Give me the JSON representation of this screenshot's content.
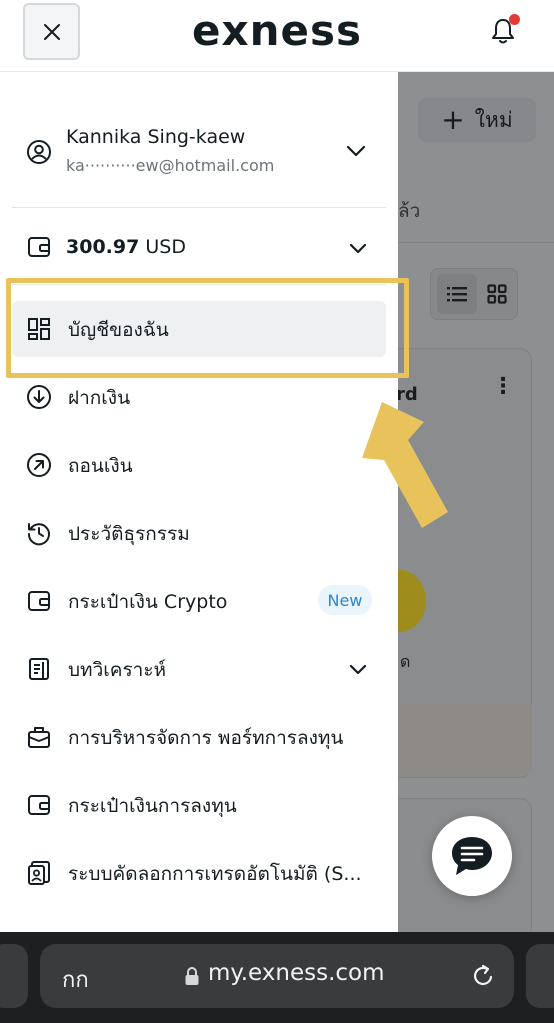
{
  "header": {
    "logo": "exness"
  },
  "background_page": {
    "new_button_label": "ใหม่",
    "partial_text_1": "ล้ว",
    "card_title_partial": "rd",
    "card_more": "⋮",
    "yellow_label_partial": "ด"
  },
  "drawer": {
    "user": {
      "name": "Kannika Sing-kaew",
      "email": "ka··········ew@hotmail.com"
    },
    "balance": {
      "amount": "300.97",
      "currency": "USD"
    },
    "menu": [
      {
        "label": "บัญชีของฉัน",
        "icon": "dashboard-icon",
        "active": true
      },
      {
        "label": "ฝากเงิน",
        "icon": "deposit-icon"
      },
      {
        "label": "ถอนเงิน",
        "icon": "withdraw-icon"
      },
      {
        "label": "ประวัติธุรกรรม",
        "icon": "history-icon"
      },
      {
        "label": "กระเป๋าเงิน Crypto",
        "icon": "wallet-icon",
        "badge": "New"
      },
      {
        "label": "บทวิเคราะห์",
        "icon": "analytics-icon",
        "expandable": true
      },
      {
        "label": "การบริหารจัดการ พอร์ทการลงทุน",
        "icon": "portfolio-icon"
      },
      {
        "label": "กระเป๋าเงินการลงทุน",
        "icon": "wallet-icon"
      },
      {
        "label": "ระบบคัดลอกการเทรดอัตโนมัติ (S...",
        "icon": "copy-trading-icon"
      }
    ]
  },
  "browser": {
    "text_size": "กก",
    "url": "my.exness.com"
  },
  "colors": {
    "highlight": "#e8c35c",
    "badge_text": "#2f86c8",
    "badge_bg": "#eaf4fb",
    "notification_dot": "#e53935"
  }
}
